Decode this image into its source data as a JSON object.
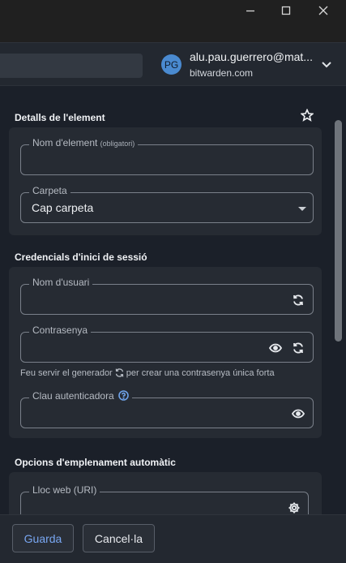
{
  "window": {
    "minimize_icon": "minimize-icon",
    "maximize_icon": "maximize-icon",
    "close_icon": "close-icon"
  },
  "account": {
    "initials": "PG",
    "email": "alu.pau.guerrero@mat...",
    "server": "bitwarden.com",
    "avatar_color": "#4a8ad0"
  },
  "item_details": {
    "title": "Detalls de l'element",
    "name_label": "Nom d'element",
    "name_hint": "(obligatori)",
    "name_value": "",
    "folder_label": "Carpeta",
    "folder_value": "Cap carpeta"
  },
  "login_credentials": {
    "title": "Credencials d'inici de sessió",
    "username_label": "Nom d'usuari",
    "username_value": "",
    "password_label": "Contrasenya",
    "password_value": "",
    "generator_hint_before": "Feu servir el generador",
    "generator_hint_after": "per crear una contrasenya única forta",
    "authenticator_label": "Clau autenticadora",
    "authenticator_value": ""
  },
  "autofill": {
    "title": "Opcions d'emplenament automàtic",
    "uri_label": "Lloc web (URI)",
    "uri_value": ""
  },
  "footer": {
    "save_label": "Guarda",
    "cancel_label": "Cancel·la"
  },
  "colors": {
    "background": "#1b2029",
    "card": "#262b33",
    "accent": "#79a7f2"
  }
}
